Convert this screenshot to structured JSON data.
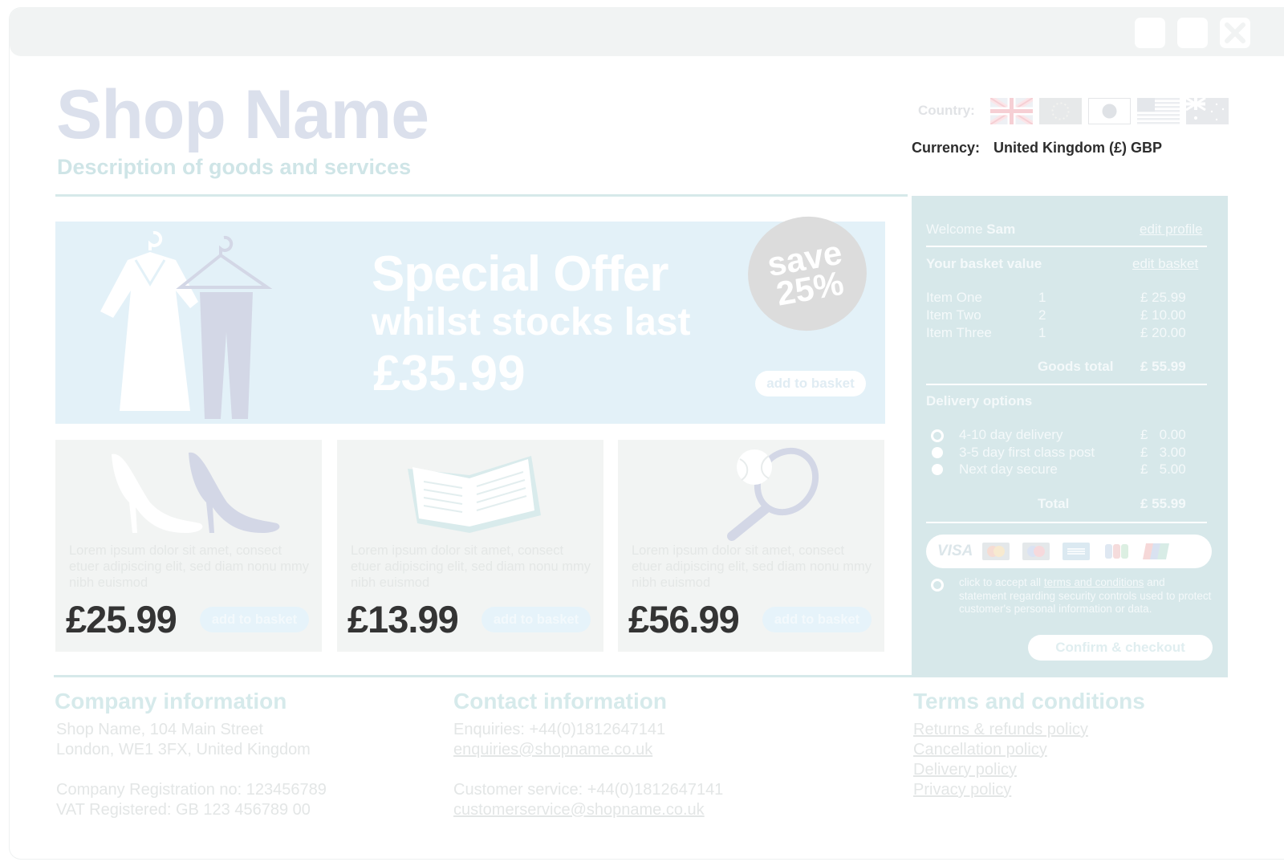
{
  "window": {
    "controls": [
      "minimize",
      "maximize",
      "close"
    ]
  },
  "header": {
    "shop_name": "Shop Name",
    "description": "Description of goods and services",
    "country_label": "Country:",
    "flags": [
      "uk-flag",
      "eu-flag",
      "japan-flag",
      "usa-flag",
      "australia-flag"
    ],
    "currency_label": "Currency:",
    "currency_value": "United Kingdom (£) GBP"
  },
  "hero": {
    "title": "Special Offer",
    "subtitle": "whilst stocks last",
    "price": "£35.99",
    "badge_line1": "save",
    "badge_line2": "25%",
    "add_label": "add to basket"
  },
  "products": [
    {
      "icon": "high-heel-shoes-icon",
      "desc": "Lorem ipsum dolor sit amet, consect etuer adipiscing elit, sed diam nonu mmy nibh euismod",
      "price": "£25.99",
      "add_label": "add to basket"
    },
    {
      "icon": "open-book-icon",
      "desc": "Lorem ipsum dolor sit amet, consect etuer adipiscing elit, sed diam nonu mmy nibh euismod",
      "price": "£13.99",
      "add_label": "add to basket"
    },
    {
      "icon": "tennis-racket-icon",
      "desc": "Lorem ipsum dolor sit amet, consect etuer adipiscing elit, sed diam nonu mmy nibh euismod",
      "price": "£56.99",
      "add_label": "add to basket"
    }
  ],
  "basket": {
    "welcome_prefix": "Welcome",
    "user": "Sam",
    "edit_profile": "edit profile",
    "value_title": "Your basket value",
    "edit_basket": "edit basket",
    "items": [
      {
        "name": "Item One",
        "qty": "1",
        "price": "£ 25.99"
      },
      {
        "name": "Item Two",
        "qty": "2",
        "price": "£ 10.00"
      },
      {
        "name": "Item Three",
        "qty": "1",
        "price": "£ 20.00"
      }
    ],
    "goods_total_label": "Goods total",
    "goods_total": "£ 55.99",
    "delivery_title": "Delivery options",
    "delivery": [
      {
        "label": "4-10 day delivery",
        "price": "£   0.00",
        "selected": true
      },
      {
        "label": "3-5 day first class post",
        "price": "£   3.00",
        "selected": false
      },
      {
        "label": "Next day secure",
        "price": "£   5.00",
        "selected": false
      }
    ],
    "total_label": "Total",
    "total": "£ 55.99",
    "payment_icons": [
      "visa-icon",
      "mastercard-icon",
      "maestro-icon",
      "amex-icon",
      "jcb-icon",
      "unionpay-icon"
    ],
    "visa_text": "VISA",
    "terms_prefix": "click to accept all",
    "terms_link": "terms and conditions",
    "terms_suffix": "and statement regarding security controls used to protect customer's personal information or data.",
    "checkout_label": "Confirm & checkout"
  },
  "footer": {
    "company": {
      "title": "Company information",
      "lines": [
        "Shop Name, 104 Main Street",
        "London, WE1 3FX, United Kingdom",
        "Company Registration no: 123456789",
        "VAT Registered: GB 123 456789 00"
      ]
    },
    "contact": {
      "title": "Contact information",
      "enquiries": "Enquiries: +44(0)1812647141",
      "enquiries_email": "enquiries@shopname.co.uk",
      "service": "Customer service: +44(0)1812647141",
      "service_email": "customerservice@shopname.co.uk"
    },
    "terms": {
      "title": "Terms and conditions",
      "links": [
        "Returns & refunds policy",
        "Cancellation policy",
        "Delivery policy",
        "Privacy policy"
      ]
    }
  },
  "colors": {
    "basket_panel": "#d7e8ea",
    "hero_bg": "#e3f1f8",
    "card_bg": "#f2f4f3",
    "price_text": "#343434"
  }
}
